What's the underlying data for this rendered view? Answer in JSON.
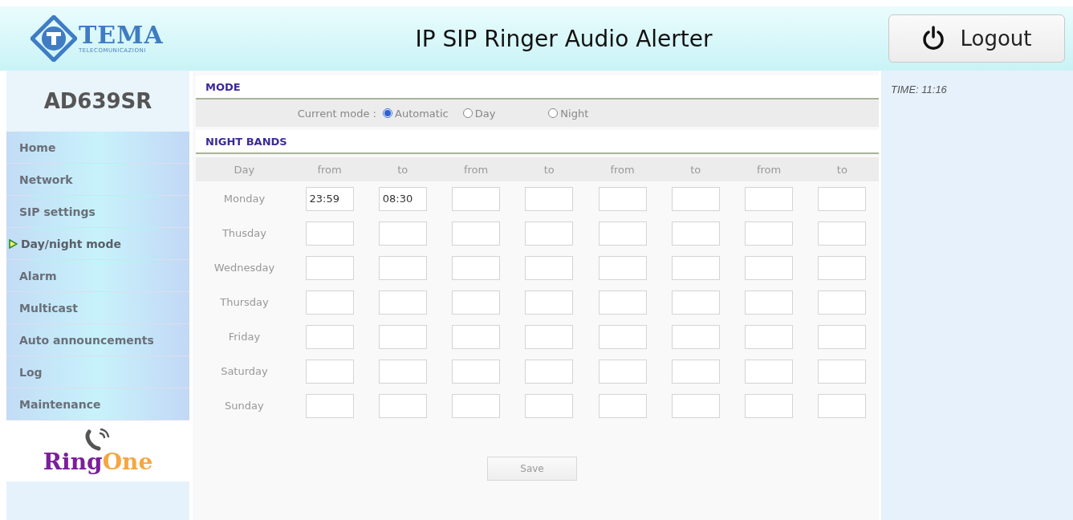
{
  "header": {
    "logo": {
      "name": "TEMA",
      "tagline": "TELECOMUNICAZIONI"
    },
    "title": "IP SIP Ringer Audio Alerter",
    "logout": "Logout"
  },
  "sidebar": {
    "model": "AD639SR",
    "items": [
      {
        "label": "Home",
        "selected": false
      },
      {
        "label": "Network",
        "selected": false
      },
      {
        "label": "SIP settings",
        "selected": false
      },
      {
        "label": "Day/night mode",
        "selected": true
      },
      {
        "label": "Alarm",
        "selected": false
      },
      {
        "label": "Multicast",
        "selected": false
      },
      {
        "label": "Auto announcements",
        "selected": false
      },
      {
        "label": "Log",
        "selected": false
      },
      {
        "label": "Maintenance",
        "selected": false
      }
    ],
    "brand": {
      "part_1": "Ring",
      "part_2": "One"
    }
  },
  "mode": {
    "heading": "MODE",
    "label": "Current mode :",
    "options": [
      {
        "label": "Automatic",
        "selected": true
      },
      {
        "label": "Day",
        "selected": false
      },
      {
        "label": "Night",
        "selected": false
      }
    ]
  },
  "night_bands": {
    "heading": "NIGHT BANDS",
    "columns": [
      "Day",
      "from",
      "to",
      "from",
      "to",
      "from",
      "to",
      "from",
      "to"
    ],
    "rows": [
      {
        "day": "Monday",
        "values": [
          "23:59",
          "08:30"
        ]
      },
      {
        "day": "Thusday"
      },
      {
        "day": "Wednesday"
      },
      {
        "day": "Thursday"
      },
      {
        "day": "Friday"
      },
      {
        "day": "Saturday"
      },
      {
        "day": "Sunday"
      }
    ],
    "save": "Save"
  },
  "time": "TIME: 11:16"
}
